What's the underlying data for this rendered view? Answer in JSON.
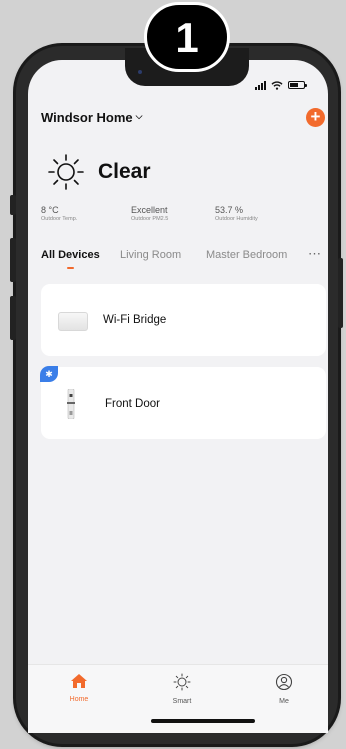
{
  "step_badge": "1",
  "header": {
    "home_name": "Windsor Home"
  },
  "weather": {
    "condition": "Clear",
    "stats": [
      {
        "value": "8 °C",
        "label": "Outdoor Temp."
      },
      {
        "value": "Excellent",
        "label": "Outdoor PM2.5"
      },
      {
        "value": "53.7 %",
        "label": "Outdoor Humidity"
      }
    ]
  },
  "tabs": [
    {
      "label": "All Devices",
      "active": true
    },
    {
      "label": "Living Room",
      "active": false
    },
    {
      "label": "Master Bedroom",
      "active": false
    }
  ],
  "devices": [
    {
      "name": "Wi-Fi Bridge",
      "icon": "wifi-bridge-icon"
    },
    {
      "name": "Front Door",
      "icon": "smart-lock-icon",
      "badge": "bluetooth-icon"
    }
  ],
  "bottom_nav": [
    {
      "label": "Home",
      "icon": "home-icon",
      "active": true
    },
    {
      "label": "Smart",
      "icon": "sun-icon",
      "active": false
    },
    {
      "label": "Me",
      "icon": "user-icon",
      "active": false
    }
  ],
  "colors": {
    "accent": "#f26a2c",
    "bluetooth": "#3a7ee8",
    "background": "#f2f2f4"
  }
}
